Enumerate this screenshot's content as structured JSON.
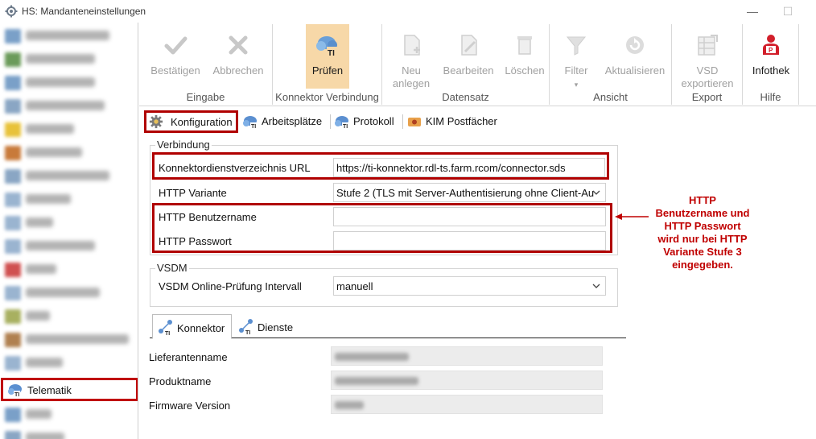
{
  "window": {
    "title": "HS: Mandanteneinstellungen",
    "minimize_glyph": "—",
    "maximize_glyph": "☐"
  },
  "sidebar": {
    "items": [
      {
        "icon": "blurred-icon",
        "color": "#7aa0c8"
      },
      {
        "icon": "blurred-icon",
        "color": "#6b9b5a"
      },
      {
        "icon": "blurred-icon",
        "color": "#7aa0c8"
      },
      {
        "icon": "blurred-icon",
        "color": "#8aa6c4"
      },
      {
        "icon": "blurred-icon",
        "color": "#e8c23a"
      },
      {
        "icon": "blurred-icon",
        "color": "#c87a3a"
      },
      {
        "icon": "blurred-icon",
        "color": "#8aa6c4"
      },
      {
        "icon": "blurred-icon",
        "color": "#9ab4d0"
      },
      {
        "icon": "blurred-icon",
        "color": "#9ab4d0"
      },
      {
        "icon": "blurred-icon",
        "color": "#9ab4d0"
      },
      {
        "icon": "blurred-icon",
        "color": "#d05050"
      },
      {
        "icon": "blurred-icon",
        "color": "#9ab4d0"
      },
      {
        "icon": "blurred-icon",
        "color": "#a8b060"
      },
      {
        "icon": "blurred-icon",
        "color": "#b08050"
      },
      {
        "icon": "blurred-icon",
        "color": "#9ab4d0"
      }
    ],
    "active_item": {
      "label": "Telematik",
      "icon": "telematik-icon"
    },
    "below_items": [
      {
        "icon": "blurred-icon",
        "color": "#7aa0c8"
      },
      {
        "icon": "blurred-icon",
        "color": "#8aa6c4"
      }
    ]
  },
  "ribbon": {
    "groups": {
      "eingabe": "Eingabe",
      "konnektor": "Konnektor Verbindung",
      "datensatz": "Datensatz",
      "ansicht": "Ansicht",
      "export": "Export",
      "hilfe": "Hilfe"
    },
    "buttons": {
      "bestaetigen": "Bestätigen",
      "abbrechen": "Abbrechen",
      "pruefen": "Prüfen",
      "neu_line1": "Neu",
      "neu_line2": "anlegen",
      "bearbeiten": "Bearbeiten",
      "loeschen": "Löschen",
      "filter": "Filter",
      "aktualisieren": "Aktualisieren",
      "vsd_line1": "VSD",
      "vsd_line2": "exportieren",
      "infothek": "Infothek"
    },
    "pruefen_badge": "TI"
  },
  "tabs": [
    {
      "label": "Konfiguration",
      "icon": "gear-icon"
    },
    {
      "label": "Arbeitsplätze",
      "icon": "ti-cloud-icon"
    },
    {
      "label": "Protokoll",
      "icon": "ti-cloud-icon"
    },
    {
      "label": "KIM Postfächer",
      "icon": "kim-icon"
    }
  ],
  "verbindung": {
    "title": "Verbindung",
    "url_label": "Konnektordienstverzeichnis URL",
    "url_value": "https://ti-konnektor.rdl-ts.farm.rcom/connector.sds",
    "variant_label": "HTTP Variante",
    "variant_value": "Stufe 2 (TLS mit Server-Authentisierung ohne Client-Au",
    "user_label": "HTTP Benutzername",
    "user_value": "",
    "password_label": "HTTP Passwort",
    "password_value": ""
  },
  "vsdm": {
    "title": "VSDM",
    "interval_label": "VSDM Online-Prüfung Intervall",
    "interval_value": "manuell"
  },
  "annotation": {
    "lines": [
      "HTTP",
      "Benutzername und",
      "HTTP Passwort",
      "wird nur bei HTTP",
      "Variante Stufe 3",
      "eingegeben."
    ],
    "color": "#c00000"
  },
  "subtabs": [
    {
      "label": "Konnektor",
      "icon": "ti-network-icon"
    },
    {
      "label": "Dienste",
      "icon": "ti-network-icon"
    }
  ],
  "details": {
    "lieferant_label": "Lieferantenname",
    "produkt_label": "Produktname",
    "firmware_label": "Firmware Version"
  },
  "colors": {
    "highlight_red": "#b00000",
    "pressed_bg": "#f7d8a8"
  }
}
